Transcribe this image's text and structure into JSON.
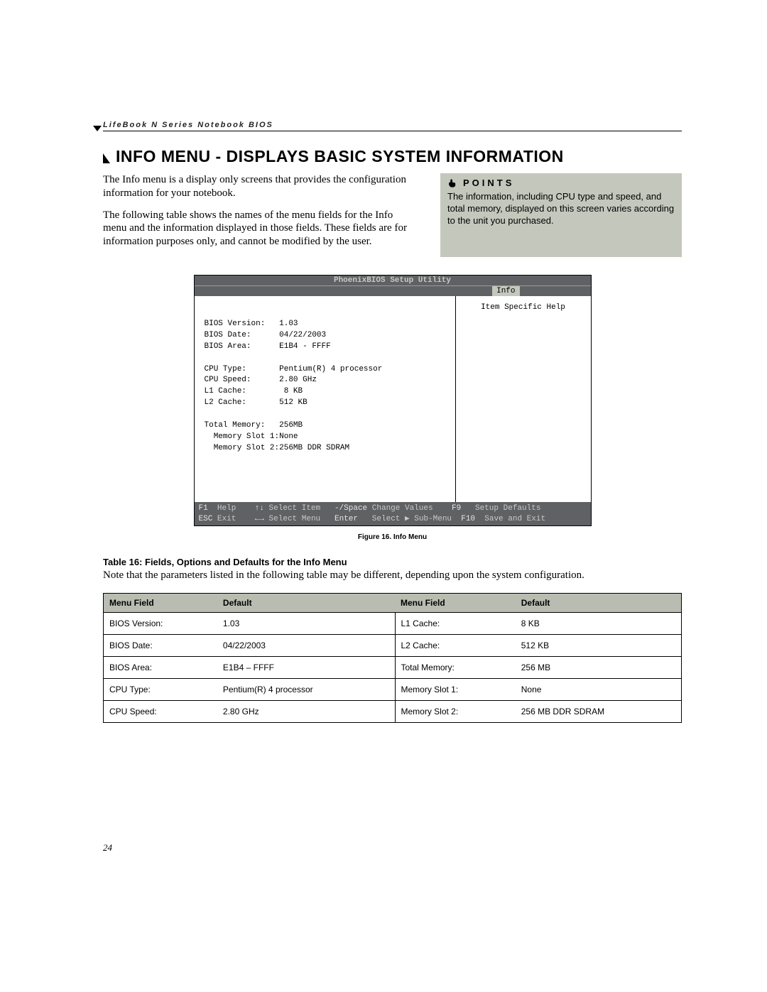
{
  "header": "LifeBook N Series Notebook BIOS",
  "title": "INFO MENU - DISPLAYS BASIC SYSTEM INFORMATION",
  "intro_p1": "The Info menu is a display only screens that provides the configuration information for your notebook.",
  "intro_p2": "The following table shows the names of the menu fields for the Info menu and the information displayed in those fields. These fields are for information purposes only, and cannot be modified by the user.",
  "points": {
    "heading": "POINTS",
    "body": "The information, including CPU type and speed, and total memory, displayed on this screen varies according to the unit you purchased."
  },
  "bios": {
    "utility_title": "PhoenixBIOS Setup Utility",
    "tab": "Info",
    "help_title": "Item Specific Help",
    "fields": [
      {
        "label": "BIOS Version:",
        "value": "1.03"
      },
      {
        "label": "BIOS Date:",
        "value": "04/22/2003"
      },
      {
        "label": "BIOS Area:",
        "value": "E1B4 - FFFF"
      },
      {
        "label": "",
        "value": ""
      },
      {
        "label": "CPU Type:",
        "value": "Pentium(R) 4 processor"
      },
      {
        "label": "CPU Speed:",
        "value": "2.80 GHz"
      },
      {
        "label": "L1 Cache:",
        "value": " 8 KB"
      },
      {
        "label": "L2 Cache:",
        "value": "512 KB"
      },
      {
        "label": "",
        "value": ""
      },
      {
        "label": "Total Memory:",
        "value": "256MB"
      },
      {
        "label": "  Memory Slot 1:",
        "value": "None"
      },
      {
        "label": "  Memory Slot 2:",
        "value": "256MB DDR SDRAM"
      }
    ],
    "footer": {
      "f1": "F1",
      "help": "Help",
      "arrows_v": "↑↓",
      "select_item": "Select Item",
      "minus_space": "-/Space",
      "change_values": "Change Values",
      "f9": "F9",
      "setup_defaults": "Setup Defaults",
      "esc": "ESC",
      "exit": "Exit",
      "arrows_h": "←→",
      "select_menu": "Select Menu",
      "enter": "Enter",
      "select_submenu": "Select ▶ Sub-Menu",
      "f10": "F10",
      "save_exit": "Save and Exit"
    }
  },
  "figure_caption": "Figure 16.  Info Menu",
  "table_title": "Table 16: Fields, Options and Defaults for the Info Menu",
  "table_note": "Note that the parameters listed in the following table may be different, depending upon the system configuration.",
  "table_headers": [
    "Menu Field",
    "Default",
    "Menu Field",
    "Default"
  ],
  "table_rows": [
    [
      "BIOS Version:",
      "1.03",
      "L1 Cache:",
      "8 KB"
    ],
    [
      "BIOS Date:",
      "04/22/2003",
      "L2 Cache:",
      "512 KB"
    ],
    [
      "BIOS Area:",
      "E1B4 – FFFF",
      "Total Memory:",
      "256 MB"
    ],
    [
      "CPU Type:",
      "Pentium(R) 4 processor",
      "Memory Slot 1:",
      "None"
    ],
    [
      "CPU Speed:",
      "2.80 GHz",
      "Memory Slot 2:",
      "256 MB DDR SDRAM"
    ]
  ],
  "page_number": "24"
}
